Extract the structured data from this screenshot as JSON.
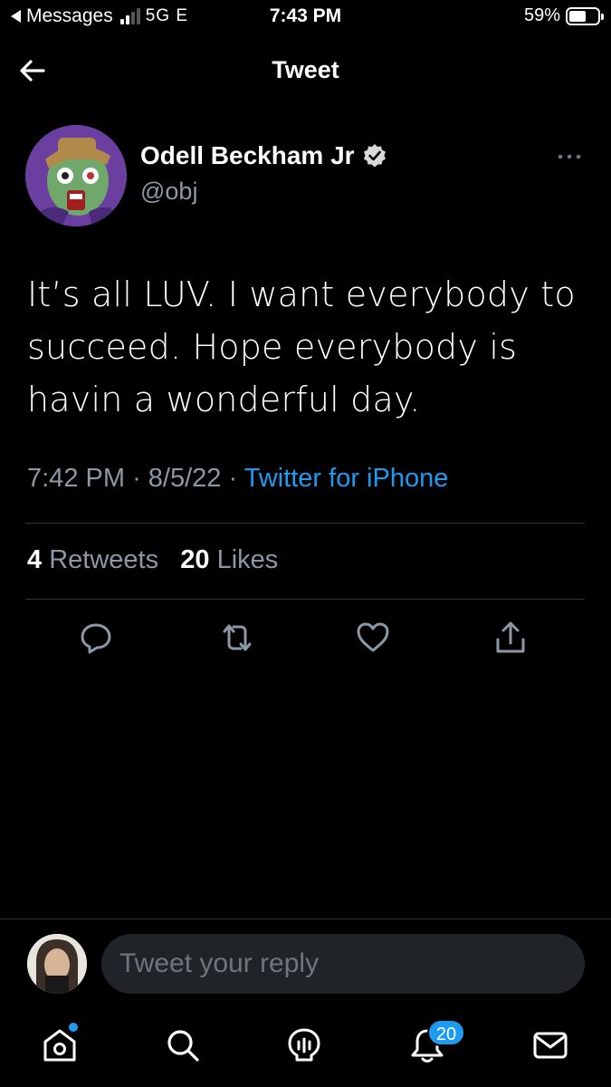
{
  "status_bar": {
    "back_app": "Messages",
    "network": "5G E",
    "time": "7:43 PM",
    "battery": "59%",
    "battery_level": 0.59
  },
  "header": {
    "title": "Tweet"
  },
  "tweet": {
    "author_name": "Odell Beckham Jr",
    "author_handle": "@obj",
    "text": "It’s all LUV. I want everybody to succeed. Hope everybody is havin a wonderful day.",
    "time": "7:42 PM",
    "date": "8/5/22",
    "source": "Twitter for iPhone",
    "retweet_count": "4",
    "retweet_label": "Retweets",
    "like_count": "20",
    "like_label": "Likes"
  },
  "reply": {
    "placeholder": "Tweet your reply"
  },
  "tabbar": {
    "notification_badge": "20"
  },
  "colors": {
    "accent": "#1d9bf0",
    "muted": "#8b98a5",
    "background": "#000000"
  }
}
